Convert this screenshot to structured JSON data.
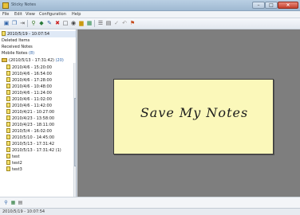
{
  "window": {
    "title": "Sticky Notes"
  },
  "menu": [
    "File",
    "Edit",
    "View",
    "Configuration",
    "Help"
  ],
  "toolbar_icons": [
    "new-note-icon",
    "copy-icon",
    "move-icon",
    "search-icon",
    "tag-icon",
    "edit-icon",
    "delete-icon",
    "box-icon",
    "camera-icon",
    "folder-icon",
    "image-icon",
    "list-icon",
    "grid-icon",
    "check-icon",
    "undo-icon",
    "pin-icon"
  ],
  "sidebar": {
    "top_note": "2010/5/19 - 10:07:54",
    "deleted": "Deleted Items",
    "received": "Received Notes",
    "mobile": "Mobile Notes",
    "mobile_badge": "(8)",
    "group": {
      "label": "(2010/5/13 - 17:31:42)",
      "badge": "(20)"
    },
    "items": [
      "2010/4/6 - 15:20:00",
      "2010/4/6 - 16:54:00",
      "2010/4/6 - 17:28:00",
      "2010/4/6 - 10:48:00",
      "2010/4/6 - 11:24:00",
      "2010/4/6 - 11:02:00",
      "2010/4/6 - 11:42:00",
      "2010/4/21 - 10:27:00",
      "2010/4/23 - 13:58:00",
      "2010/4/23 - 18:11:00",
      "2010/5/4 - 16:02:00",
      "2010/5/10 - 14:45:00",
      "2010/5/13 - 17:31:42",
      "2010/5/13 - 17:31:42 (1)",
      "test",
      "test2",
      "test3"
    ]
  },
  "note": {
    "text": "Save My Notes",
    "color": "#fbf8ba"
  },
  "bottom_icons": [
    "search-icon",
    "grid-icon",
    "list-icon"
  ],
  "status": {
    "text": "2010/5/19 - 10:07:54"
  }
}
